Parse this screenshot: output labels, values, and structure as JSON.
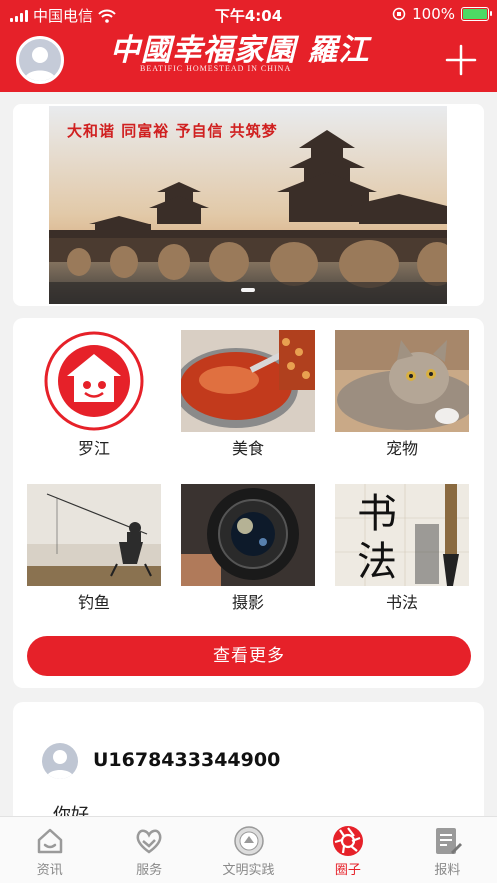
{
  "status_bar": {
    "carrier": "中国电信",
    "time": "下午4:04",
    "battery": "100%",
    "battery_level": 1.0
  },
  "header": {
    "logo_text": "中國幸福家園 羅江",
    "logo_subtitle": "BEATIFIC HOMESTEAD IN CHINA",
    "avatar_icon": "user-avatar-icon",
    "add_icon": "plus-icon"
  },
  "banner": {
    "slogan": "大和谐 同富裕 予自信 共筑梦"
  },
  "categories": [
    {
      "label": "罗江",
      "icon": "homestead-logo"
    },
    {
      "label": "美食",
      "icon": "hotpot-photo"
    },
    {
      "label": "宠物",
      "icon": "cat-photo"
    },
    {
      "label": "钓鱼",
      "icon": "fishing-photo"
    },
    {
      "label": "摄影",
      "icon": "camera-lens-photo"
    },
    {
      "label": "书法",
      "icon": "calligraphy-photo"
    }
  ],
  "more_button": "查看更多",
  "post": {
    "username": "U1678433344900",
    "text": "你好"
  },
  "tabs": [
    {
      "label": "资讯",
      "icon": "home-icon",
      "active": false
    },
    {
      "label": "服务",
      "icon": "handshake-heart-icon",
      "active": false
    },
    {
      "label": "文明实践",
      "icon": "civilization-badge-icon",
      "active": false
    },
    {
      "label": "圈子",
      "icon": "shutter-icon",
      "active": true
    },
    {
      "label": "报料",
      "icon": "edit-document-icon",
      "active": false
    }
  ],
  "colors": {
    "brand": "#e62129",
    "battery_fill": "#4cd964"
  }
}
